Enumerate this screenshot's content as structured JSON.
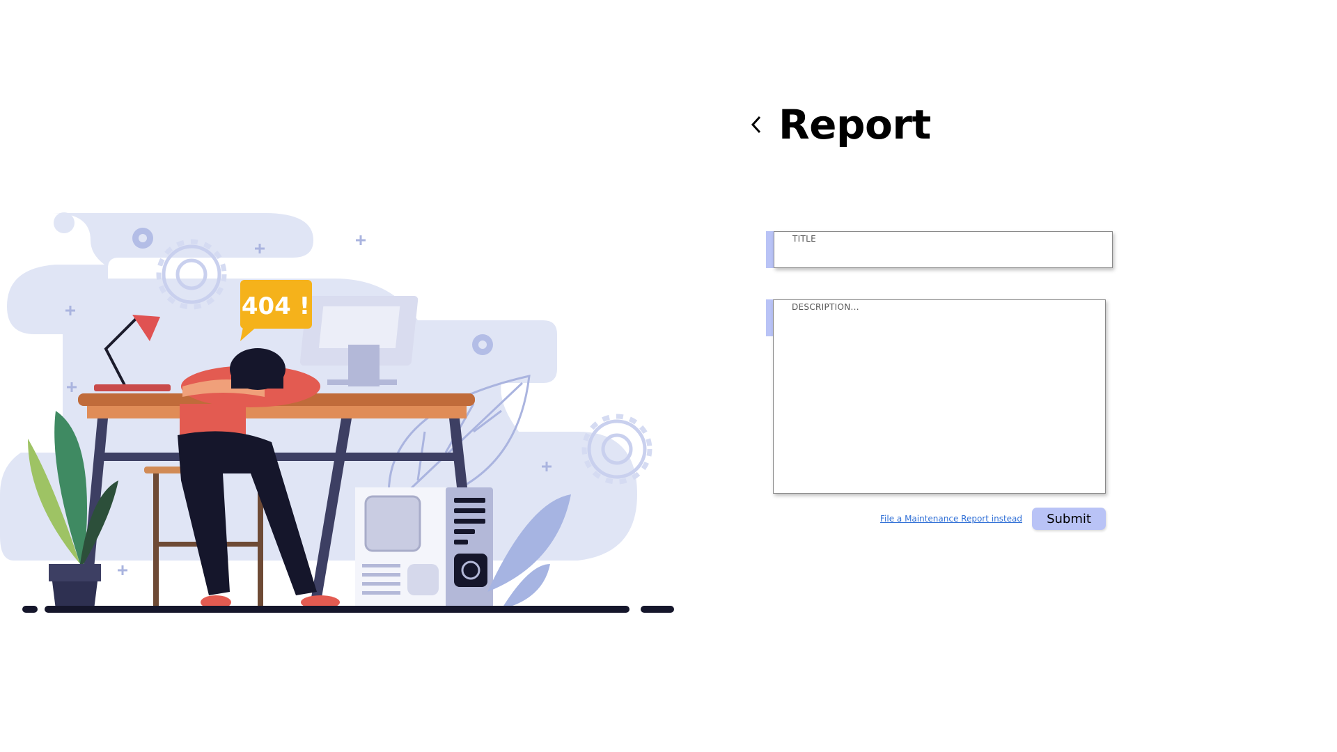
{
  "page": {
    "title": "Report",
    "back_icon": "chevron-left-icon"
  },
  "illustration": {
    "badge_text": "404 !"
  },
  "form": {
    "title_placeholder": "TITLE",
    "title_value": "",
    "description_placeholder": "DESCRIPTION...",
    "description_value": "",
    "alt_link": "File a Maintenance Report instead",
    "submit_label": "Submit"
  },
  "colors": {
    "accent": "#b9c3f6",
    "link": "#2f6fd6",
    "badge": "#f5b21b"
  }
}
